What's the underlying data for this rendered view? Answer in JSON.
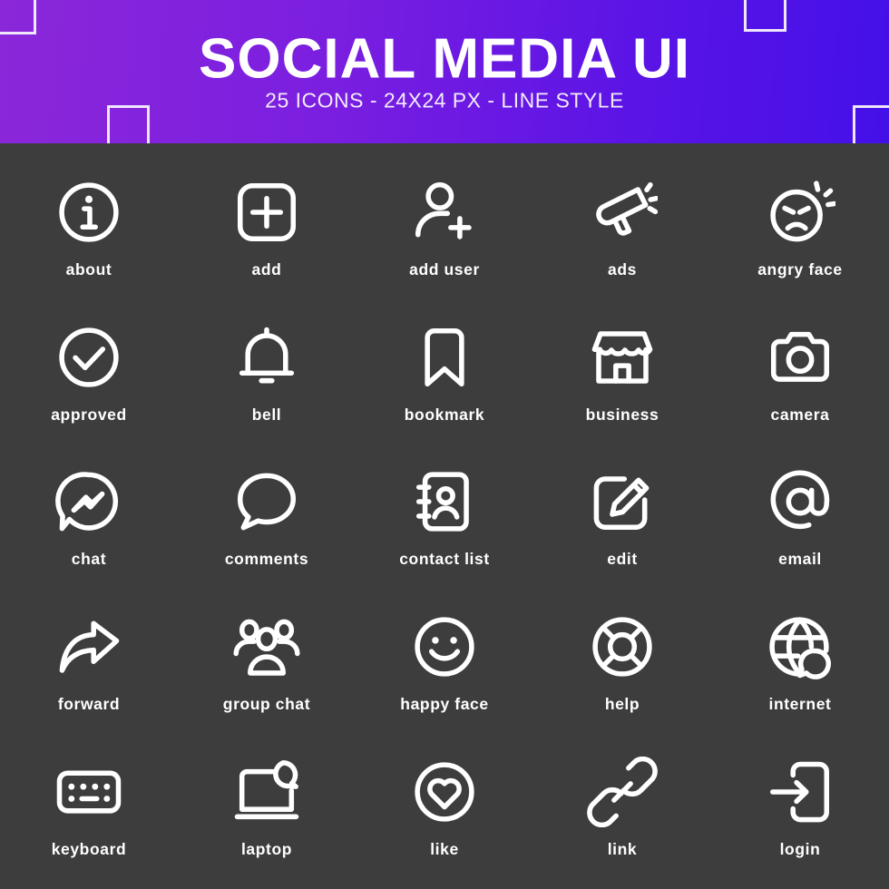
{
  "banner": {
    "title": "SOCIAL MEDIA UI",
    "subtitle": "25 ICONS - 24X24 PX - LINE STYLE",
    "gradient_start": "#8b27d9",
    "gradient_end": "#4410e8",
    "text_color": "#ffffff",
    "decoration": "outlined-squares"
  },
  "theme": {
    "background": "#3d3d3d",
    "icon_color": "#ffffff",
    "label_color": "#ffffff",
    "style": "line"
  },
  "grid": {
    "columns": 5,
    "rows": 5,
    "count": 25
  },
  "icons": [
    {
      "label": "about",
      "name": "about-icon"
    },
    {
      "label": "add",
      "name": "add-icon"
    },
    {
      "label": "add user",
      "name": "add-user-icon"
    },
    {
      "label": "ads",
      "name": "ads-icon"
    },
    {
      "label": "angry face",
      "name": "angry-face-icon"
    },
    {
      "label": "approved",
      "name": "approved-icon"
    },
    {
      "label": "bell",
      "name": "bell-icon"
    },
    {
      "label": "bookmark",
      "name": "bookmark-icon"
    },
    {
      "label": "business",
      "name": "business-icon"
    },
    {
      "label": "camera",
      "name": "camera-icon"
    },
    {
      "label": "chat",
      "name": "chat-icon"
    },
    {
      "label": "comments",
      "name": "comments-icon"
    },
    {
      "label": "contact list",
      "name": "contact-list-icon"
    },
    {
      "label": "edit",
      "name": "edit-icon"
    },
    {
      "label": "email",
      "name": "email-icon"
    },
    {
      "label": "forward",
      "name": "forward-icon"
    },
    {
      "label": "group chat",
      "name": "group-chat-icon"
    },
    {
      "label": "happy face",
      "name": "happy-face-icon"
    },
    {
      "label": "help",
      "name": "help-icon"
    },
    {
      "label": "internet",
      "name": "internet-icon"
    },
    {
      "label": "keyboard",
      "name": "keyboard-icon"
    },
    {
      "label": "laptop",
      "name": "laptop-icon"
    },
    {
      "label": "like",
      "name": "like-icon"
    },
    {
      "label": "link",
      "name": "link-icon"
    },
    {
      "label": "login",
      "name": "login-icon"
    }
  ]
}
